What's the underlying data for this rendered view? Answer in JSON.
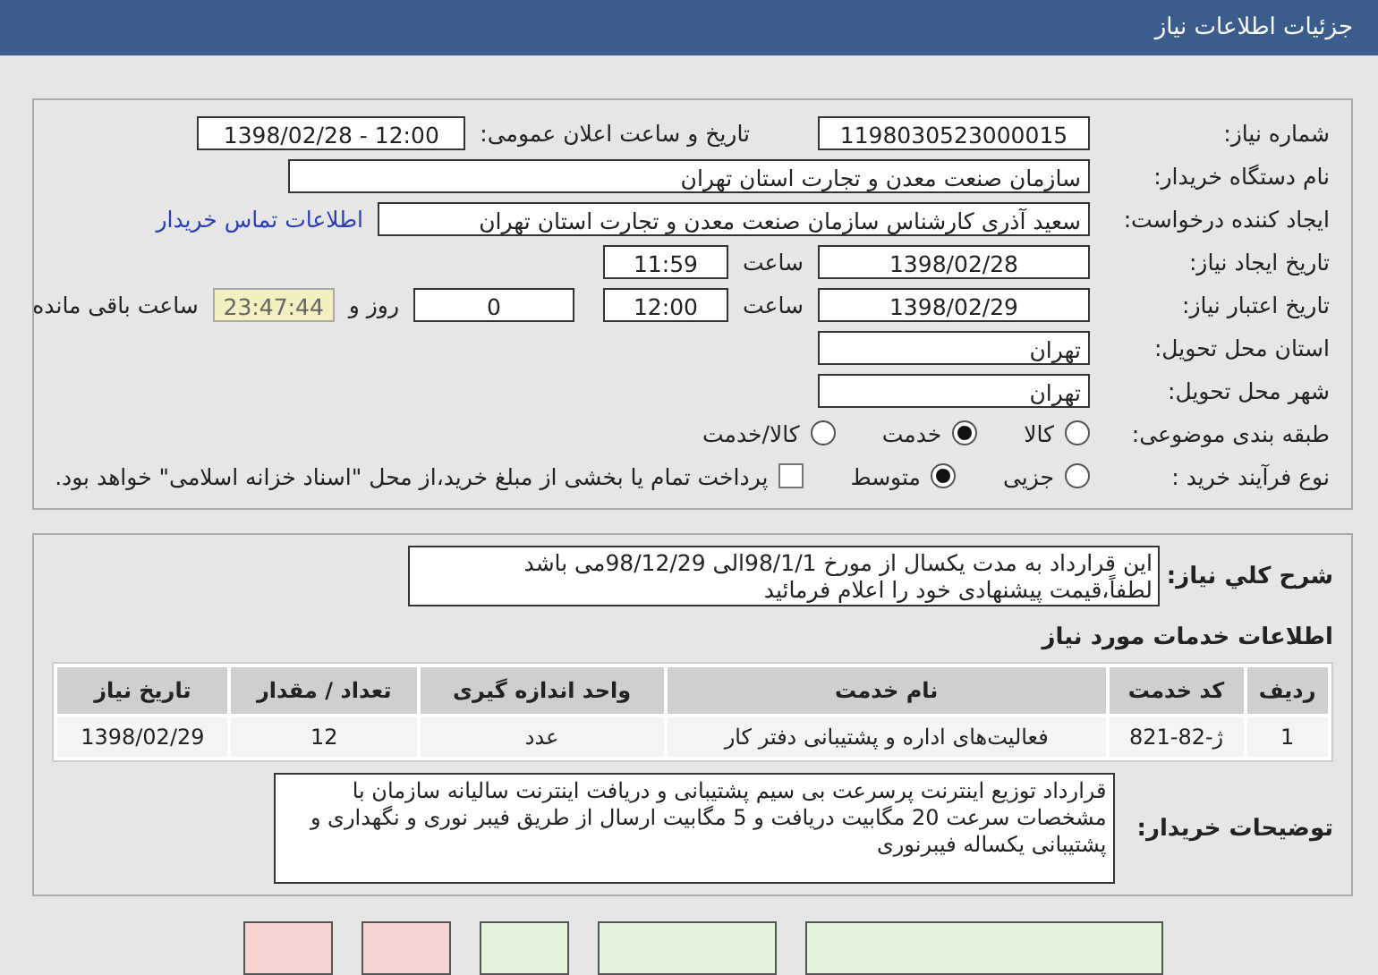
{
  "header": {
    "title": "جزئیات اطلاعات نیاز"
  },
  "details": {
    "need_number": {
      "label": "شماره نیاز:",
      "value": "1198030523000015"
    },
    "announce": {
      "label": "تاریخ و ساعت اعلان عمومی:",
      "value": "1398/02/28 - 12:00"
    },
    "buyer_org": {
      "label": "نام دستگاه خریدار:",
      "value": "سازمان صنعت معدن و تجارت استان تهران"
    },
    "requester": {
      "label": "ایجاد کننده درخواست:",
      "value": "سعید آذری کارشناس سازمان صنعت معدن و تجارت استان تهران",
      "link": "اطلاعات تماس خریدار"
    },
    "created": {
      "label": "تاریخ ایجاد نیاز:",
      "date": "1398/02/28",
      "time_label": "ساعت",
      "time": "11:59"
    },
    "validity": {
      "label": "تاریخ اعتبار نیاز:",
      "date": "1398/02/29",
      "time_label": "ساعت",
      "time": "12:00",
      "days": "0",
      "days_label": "روز و",
      "remaining": "23:47:44",
      "remaining_label": "ساعت باقی مانده"
    },
    "province": {
      "label": "استان محل تحویل:",
      "value": "تهران"
    },
    "city": {
      "label": "شهر محل تحویل:",
      "value": "تهران"
    },
    "category": {
      "label": "طبقه بندی موضوعی:",
      "options": [
        {
          "label": "کالا",
          "selected": false
        },
        {
          "label": "خدمت",
          "selected": true
        },
        {
          "label": "کالا/خدمت",
          "selected": false
        }
      ]
    },
    "purchase_type": {
      "label": "نوع فرآیند خرید :",
      "options": [
        {
          "label": "جزیی",
          "selected": false
        },
        {
          "label": "متوسط",
          "selected": true
        }
      ],
      "payment": {
        "label": "پرداخت تمام یا بخشی از مبلغ خرید،از محل \"اسناد خزانه اسلامی\" خواهد بود.",
        "checked": false
      }
    }
  },
  "description": {
    "label": "شرح کلي نياز:",
    "lines": [
      "این قرارداد به مدت یکسال از مورخ 98/1/1الی 98/12/29می باشد",
      "لطفاً،قیمت پیشنهادی خود را اعلام فرمائید"
    ]
  },
  "services": {
    "title": "اطلاعات خدمات مورد نیاز",
    "columns": [
      "ردیف",
      "کد خدمت",
      "نام خدمت",
      "واحد اندازه گیری",
      "تعداد / مقدار",
      "تاریخ نیاز"
    ],
    "rows": [
      [
        "1",
        "ژ-82-821",
        "فعالیت‌های اداره و پشتیبانی دفتر کار",
        "عدد",
        "12",
        "1398/02/29"
      ]
    ]
  },
  "buyer_notes": {
    "label": "توضیحات خریدار:",
    "text": "قرارداد توزیع اینترنت پرسرعت بی سیم پشتیبانی و دریافت اینترنت سالیانه سازمان با مشخصات سرعت 20 مگابیت دریافت و 5 مگابیت ارسال از طریق فیبر نوری و نگهداری و پشتیبانی یکساله فیبرنوری"
  },
  "footer_buttons": [
    {
      "color": "#e4f5dc"
    },
    {
      "color": "#e4f5dc"
    },
    {
      "color": "#e4f5dc"
    },
    {
      "color": "#f7d4d4"
    },
    {
      "color": "#f7d4d4"
    }
  ]
}
